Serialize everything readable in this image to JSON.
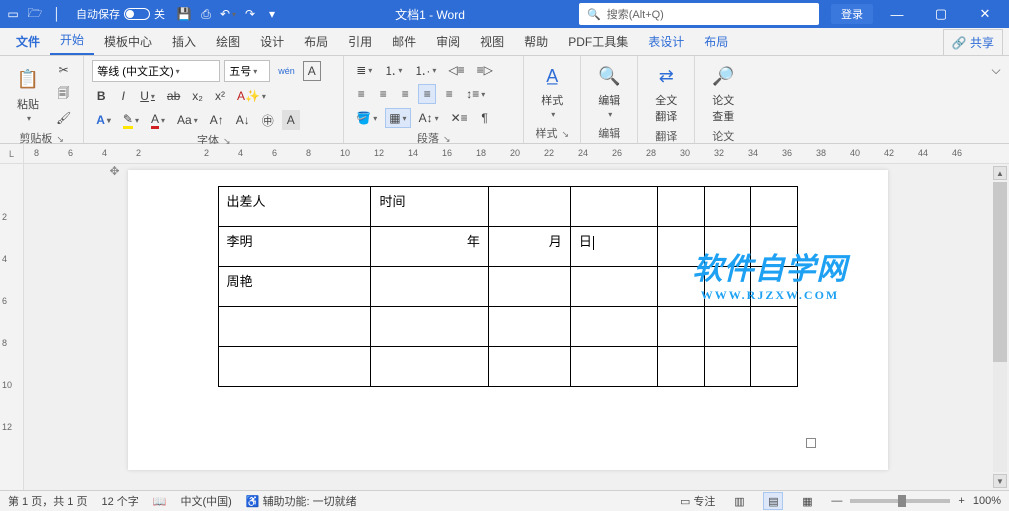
{
  "titlebar": {
    "autosave_label": "自动保存",
    "autosave_state": "关",
    "doc_title": "文档1 - Word",
    "search_placeholder": "搜索(Alt+Q)",
    "login": "登录"
  },
  "tabs": {
    "file": "文件",
    "home": "开始",
    "template": "模板中心",
    "insert": "插入",
    "draw": "绘图",
    "design": "设计",
    "layout": "布局",
    "references": "引用",
    "mailings": "邮件",
    "review": "审阅",
    "view": "视图",
    "help": "帮助",
    "pdf": "PDF工具集",
    "table_design": "表设计",
    "table_layout": "布局",
    "share": "共享"
  },
  "ribbon": {
    "clipboard": {
      "paste": "粘贴",
      "label": "剪贴板"
    },
    "font": {
      "name": "等线 (中文正文)",
      "size": "五号",
      "label": "字体",
      "wen": "wén",
      "bold": "B",
      "italic": "I",
      "underline": "U",
      "strike": "ab",
      "sub": "x₂",
      "sup": "x²",
      "A_outline": "A",
      "highlight": "✎",
      "fontcolor": "A",
      "Aa": "Aa",
      "grow": "A↑",
      "shrink": "A↓",
      "circled": "㊥",
      "boxedA": "A"
    },
    "paragraph": {
      "label": "段落"
    },
    "styles": {
      "label": "样式",
      "btn": "样式"
    },
    "editing": {
      "label": "编辑",
      "btn": "编辑"
    },
    "translate": {
      "label": "翻译",
      "btn": "全文\n翻译"
    },
    "papers": {
      "label": "论文",
      "btn": "论文\n查重"
    }
  },
  "ruler": {
    "h": [
      "8",
      "6",
      "4",
      "2",
      "",
      "2",
      "4",
      "6",
      "8",
      "10",
      "12",
      "14",
      "16",
      "18",
      "20",
      "22",
      "24",
      "26",
      "28",
      "30",
      "32",
      "34",
      "36",
      "38",
      "40",
      "42",
      "44",
      "46"
    ],
    "v": [
      "",
      "2",
      "4",
      "6",
      "8",
      "10",
      "12"
    ]
  },
  "table": {
    "r1": [
      "出差人",
      "时间",
      "",
      "",
      "",
      "",
      ""
    ],
    "r2": [
      "李明",
      "年",
      "月",
      "日",
      "",
      "",
      ""
    ],
    "r3": [
      "周艳",
      "",
      "",
      "",
      "",
      "",
      ""
    ],
    "r4": [
      "",
      "",
      "",
      "",
      "",
      "",
      ""
    ],
    "r5": [
      "",
      "",
      "",
      "",
      "",
      "",
      ""
    ]
  },
  "watermark": {
    "line1": "软件自学网",
    "line2": "WWW.RJZXW.COM"
  },
  "status": {
    "page": "第 1 页，共 1 页",
    "words": "12 个字",
    "lang": "中文(中国)",
    "access": "辅助功能: 一切就绪",
    "focus": "专注",
    "zoom": "100%"
  }
}
